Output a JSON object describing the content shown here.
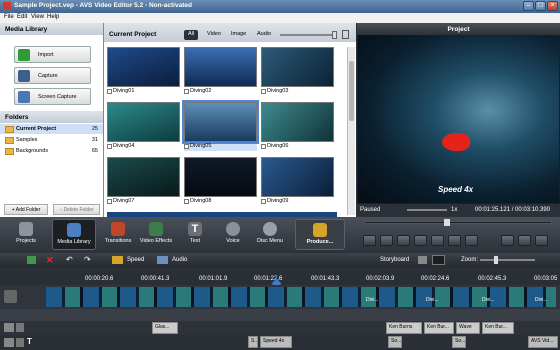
{
  "window": {
    "title": "Sample Project.vep - AVS Video Editor 5.2 - Non-activated"
  },
  "menu": [
    "File",
    "Edit",
    "View",
    "Help"
  ],
  "library": {
    "title": "Media Library",
    "buttons": [
      "Import",
      "Capture",
      "Screen Capture"
    ],
    "folders_title": "Folders",
    "folders": [
      {
        "name": "Current Project",
        "count": "25"
      },
      {
        "name": "Samples",
        "count": "31"
      },
      {
        "name": "Backgrounds",
        "count": "65"
      }
    ],
    "add_folder": "+ Add Folder",
    "delete_folder": "− Delete Folder"
  },
  "project": {
    "title": "Current Project",
    "tabs": [
      "All",
      "Video",
      "Image",
      "Audio"
    ],
    "thumbs": [
      "Diving01",
      "Diving02",
      "Diving03",
      "Diving04",
      "Diving05",
      "Diving06",
      "Diving07",
      "Diving08",
      "Diving09"
    ]
  },
  "preview": {
    "title": "Project",
    "overlay": "Speed 4x",
    "status": "Paused",
    "speed": "1x",
    "time": "00:01:25.121 / 00:03:10.390"
  },
  "toolbar": [
    "Projects",
    "Media Library",
    "Transitions",
    "Video Effects",
    "Text",
    "Voice",
    "Disc Menu",
    "Produce..."
  ],
  "timeline": {
    "speed_label": "Speed",
    "audio_label": "Audio",
    "storyboard": "Storyboard",
    "zoom": "Zoom:",
    "ticks": [
      "00:00:20.6",
      "00:00:41.3",
      "00:01:01.9",
      "00:01:22.6",
      "00:01:43.3",
      "00:02:03.9",
      "00:02:24.6",
      "00:02:45.3",
      "00:03:05"
    ],
    "clips_video": [
      "Divi...",
      "Divi...",
      "Divi...",
      "Divi..."
    ],
    "clips_effects": [
      "Glas...",
      "Ken Burns",
      "Ken Bur...",
      "Wave",
      "Ken Bur..."
    ],
    "clips_text": [
      "S...",
      "Speed 4x",
      "So...",
      "So...",
      "AVS Vid..."
    ]
  },
  "colors": {
    "accent": "#4f86d6",
    "fish": "#e5231b"
  }
}
